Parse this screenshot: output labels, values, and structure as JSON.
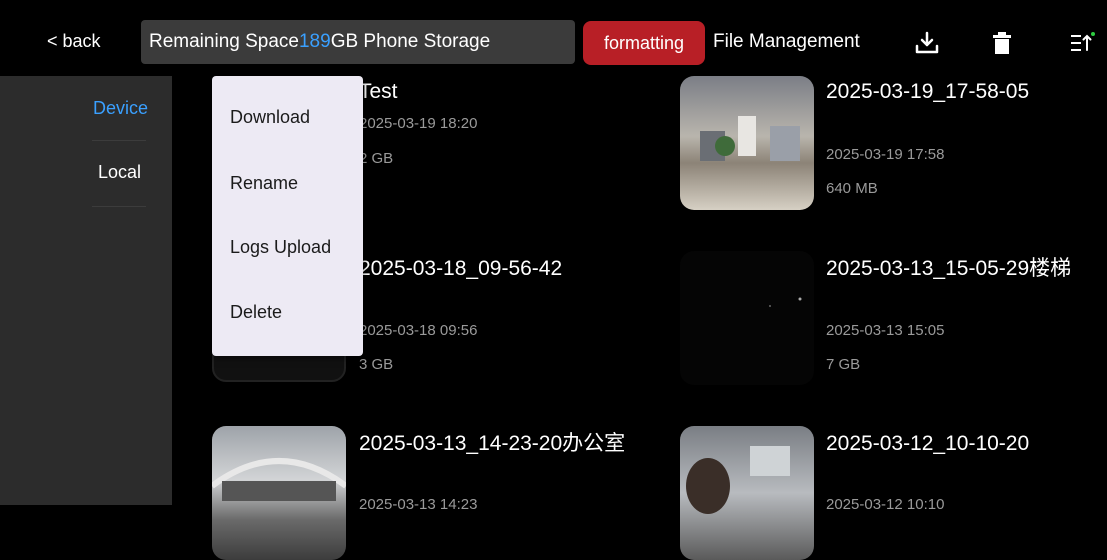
{
  "header": {
    "back_label": "< back",
    "storage_prefix": "Remaining Space",
    "storage_value": "189",
    "storage_suffix": "GB Phone Storage",
    "format_label": "formatting",
    "title": "File Management",
    "icons": [
      "download-icon",
      "trash-icon",
      "sort-icon"
    ]
  },
  "sidebar": {
    "items": [
      {
        "label": "Device",
        "active": true
      },
      {
        "label": "Local",
        "active": false
      }
    ]
  },
  "menu": {
    "items": [
      "Download",
      "Rename",
      "Logs Upload",
      "Delete"
    ]
  },
  "files": [
    {
      "name": "Test",
      "date": "2025-03-19 18:20",
      "size": "2 GB"
    },
    {
      "name": "2025-03-19_17-58-05",
      "date": "2025-03-19 17:58",
      "size": "640 MB"
    },
    {
      "name": "2025-03-18_09-56-42",
      "date": "2025-03-18 09:56",
      "size": "3 GB"
    },
    {
      "name": "2025-03-13_15-05-29楼梯",
      "date": "2025-03-13 15:05",
      "size": "7 GB"
    },
    {
      "name": "2025-03-13_14-23-20办公室",
      "date": "2025-03-13 14:23",
      "size": ""
    },
    {
      "name": "2025-03-12_10-10-20",
      "date": "2025-03-12 10:10",
      "size": ""
    }
  ],
  "colors": {
    "accent_blue": "#3aa0ff",
    "format_red": "#b81f26",
    "sidebar_bg": "#2c2c2c",
    "menu_bg": "#edeaf4"
  }
}
